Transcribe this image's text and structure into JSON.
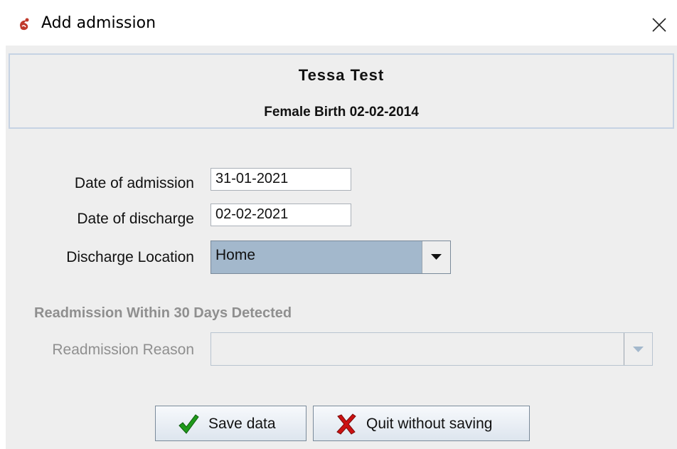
{
  "window": {
    "title": "Add admission",
    "close_glyph": "✕"
  },
  "patient": {
    "name": "Tessa Test",
    "details": "Female Birth 02-02-2014"
  },
  "form": {
    "admission_date": {
      "label": "Date of admission",
      "value": "31-01-2021"
    },
    "discharge_date": {
      "label": "Date of discharge",
      "value": "02-02-2021"
    },
    "discharge_location": {
      "label": "Discharge Location",
      "selected": "Home"
    },
    "readmission_heading": "Readmission Within 30 Days Detected",
    "readmission_reason": {
      "label": "Readmission Reason",
      "selected": ""
    }
  },
  "buttons": {
    "save": "Save data",
    "quit": "Quit without saving"
  },
  "icons": {
    "app": "app-logo-icon",
    "close": "close-icon",
    "dropdown": "chevron-down-icon",
    "save": "checkmark-icon",
    "quit": "x-mark-icon"
  },
  "colors": {
    "selection": "#a3b8cc",
    "panel_border": "#c6d3e3",
    "disabled_text": "#8f8f8f",
    "save_check": "#1f9a1a",
    "quit_x": "#cc1111"
  }
}
